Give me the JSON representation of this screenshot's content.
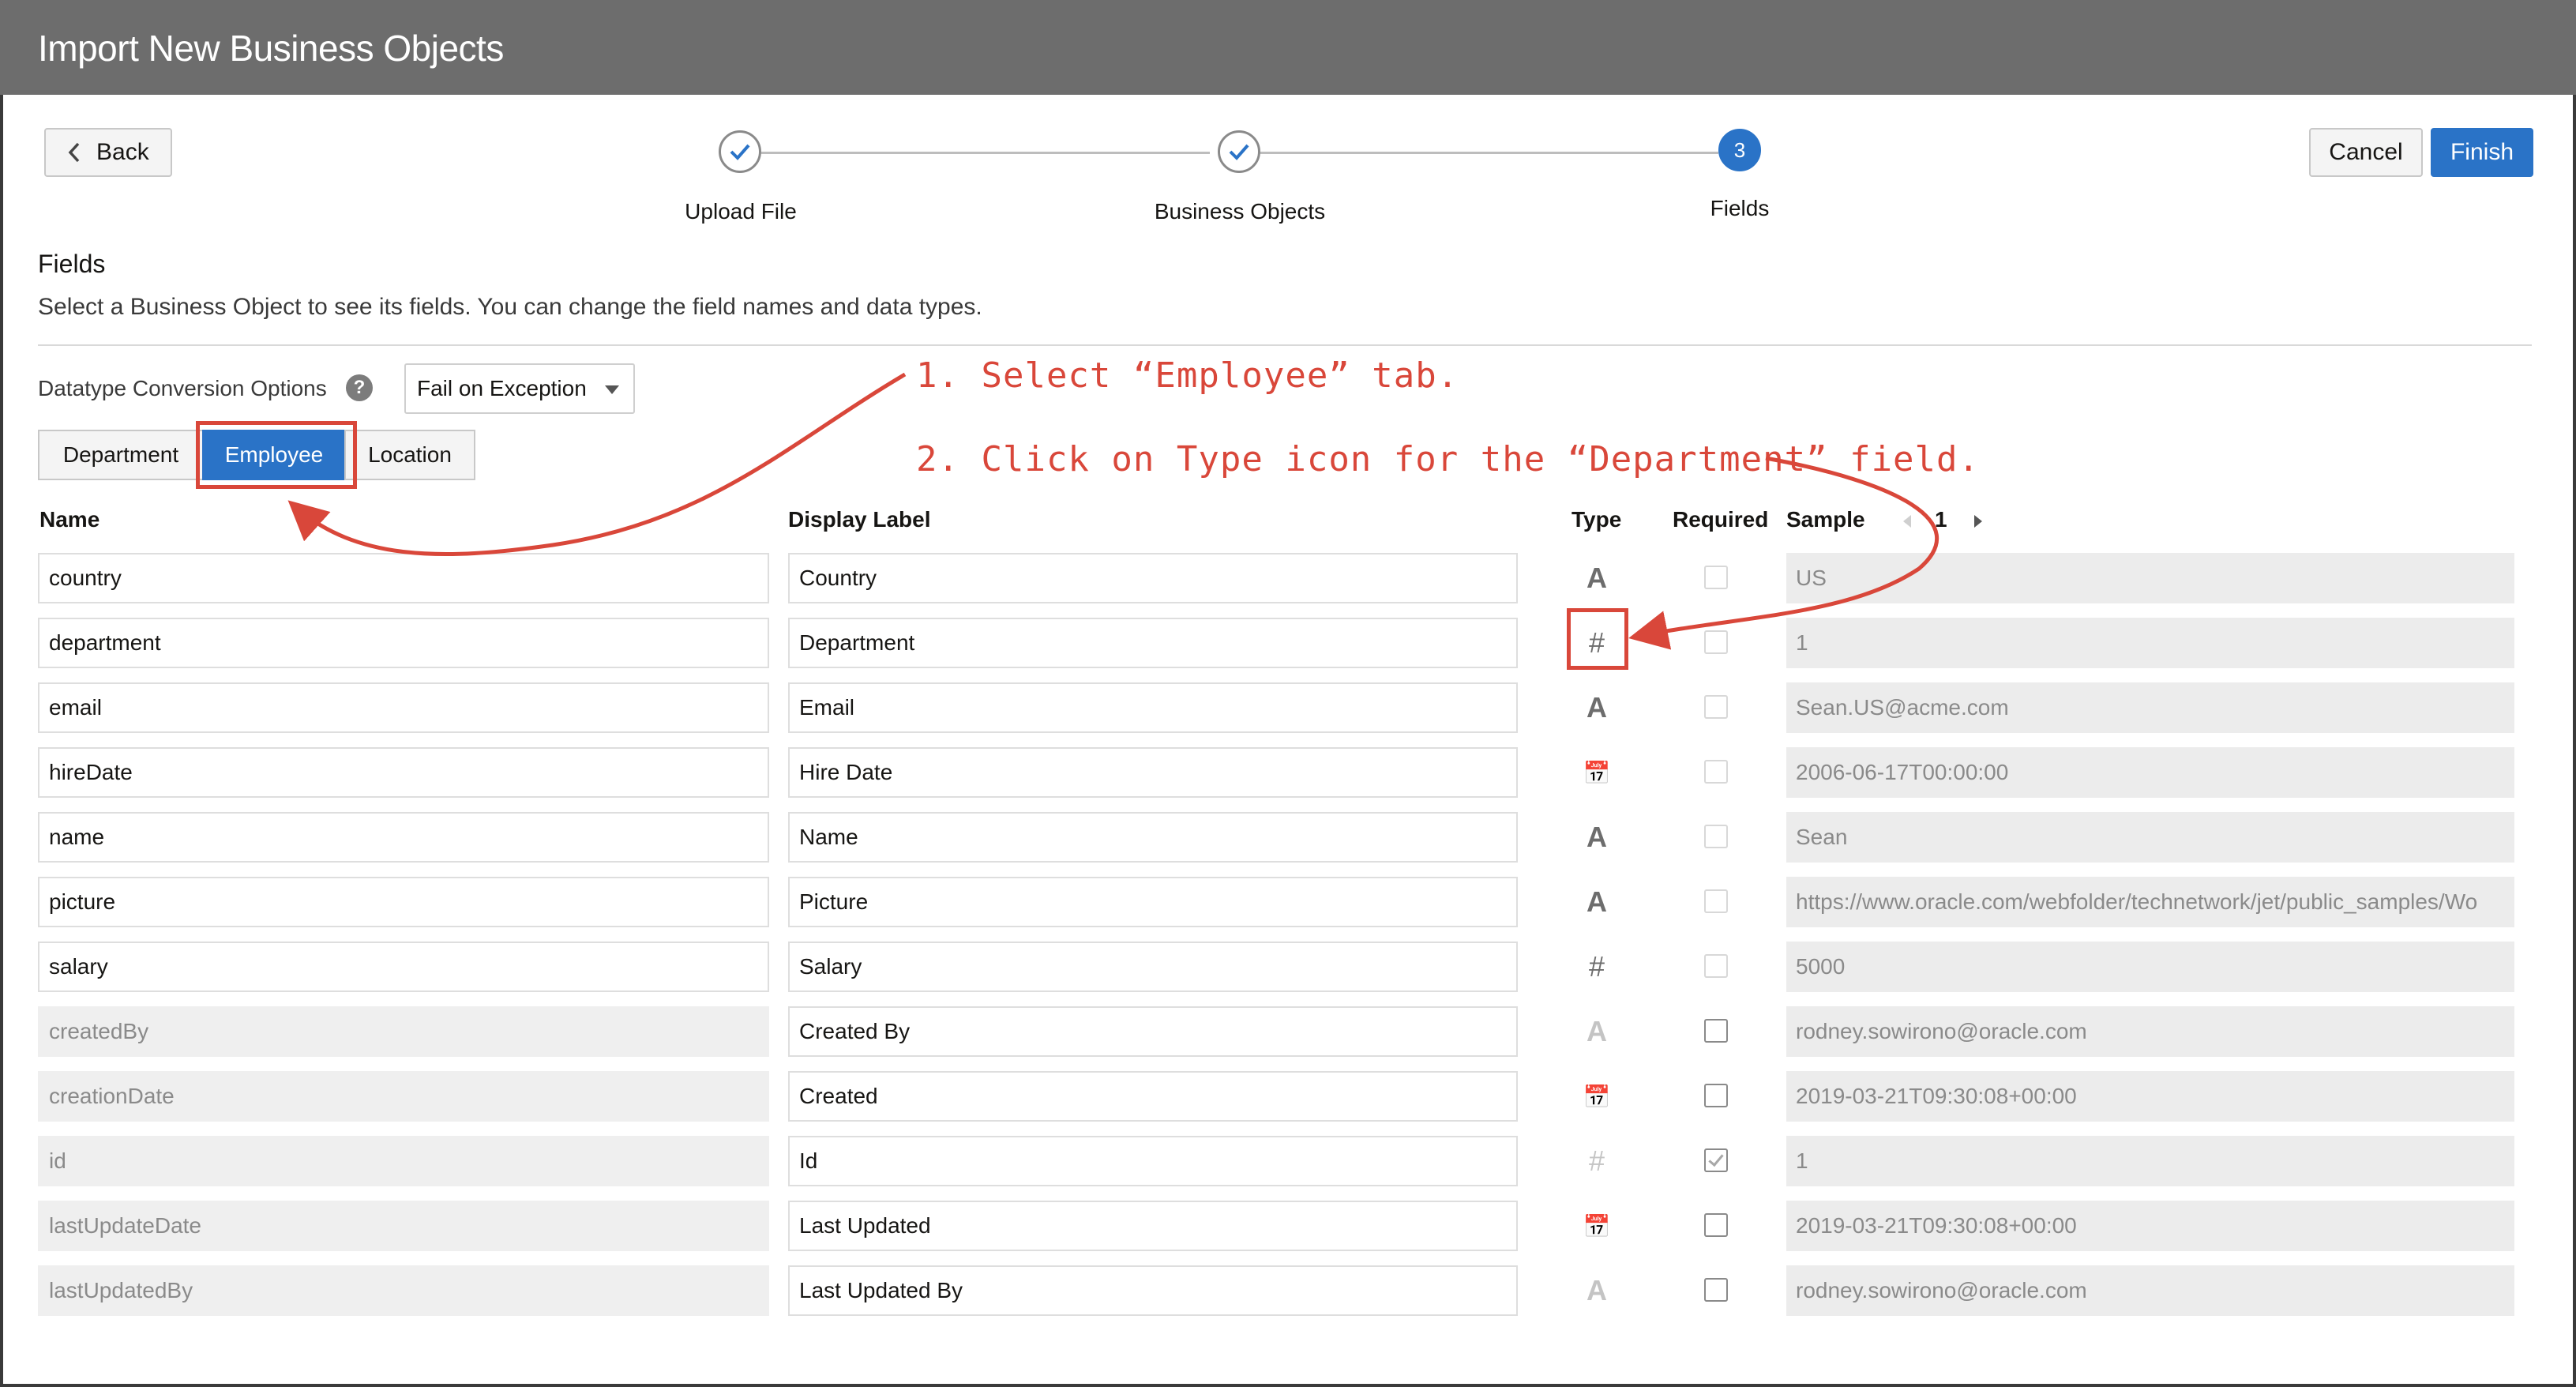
{
  "window": {
    "title": "Import New Business Objects"
  },
  "nav": {
    "back": "Back",
    "cancel": "Cancel",
    "finish": "Finish"
  },
  "train": {
    "steps": [
      {
        "label": "Upload File",
        "state": "done"
      },
      {
        "label": "Business Objects",
        "state": "done"
      },
      {
        "label": "Fields",
        "state": "current",
        "number": "3"
      }
    ]
  },
  "section": {
    "title": "Fields",
    "description": "Select a Business Object to see its fields. You can change the field names and data types."
  },
  "conversion": {
    "label": "Datatype Conversion Options",
    "value": "Fail on Exception",
    "help": "?"
  },
  "tabs": [
    {
      "label": "Department",
      "selected": false
    },
    {
      "label": "Employee",
      "selected": true
    },
    {
      "label": "Location",
      "selected": false
    }
  ],
  "table": {
    "headers": {
      "name": "Name",
      "display": "Display Label",
      "type": "Type",
      "required": "Required",
      "sample": "Sample"
    },
    "page": "1",
    "rows": [
      {
        "name": "country",
        "display": "Country",
        "type": "text",
        "glyph": "A",
        "required": false,
        "system": false,
        "sample": "US"
      },
      {
        "name": "department",
        "display": "Department",
        "type": "number",
        "glyph": "#",
        "required": false,
        "system": false,
        "sample": "1"
      },
      {
        "name": "email",
        "display": "Email",
        "type": "text",
        "glyph": "A",
        "required": false,
        "system": false,
        "sample": "Sean.US@acme.com"
      },
      {
        "name": "hireDate",
        "display": "Hire Date",
        "type": "datetime",
        "glyph": "📅",
        "required": false,
        "system": false,
        "sample": "2006-06-17T00:00:00"
      },
      {
        "name": "name",
        "display": "Name",
        "type": "text",
        "glyph": "A",
        "required": false,
        "system": false,
        "sample": "Sean"
      },
      {
        "name": "picture",
        "display": "Picture",
        "type": "text",
        "glyph": "A",
        "required": false,
        "system": false,
        "sample": "https://www.oracle.com/webfolder/technetwork/jet/public_samples/Wo"
      },
      {
        "name": "salary",
        "display": "Salary",
        "type": "number",
        "glyph": "#",
        "required": false,
        "system": false,
        "sample": "5000"
      },
      {
        "name": "createdBy",
        "display": "Created By",
        "type": "text",
        "glyph": "A",
        "required": false,
        "system": true,
        "sample": "rodney.sowirono@oracle.com"
      },
      {
        "name": "creationDate",
        "display": "Created",
        "type": "datetime",
        "glyph": "📅",
        "required": false,
        "system": true,
        "sample": "2019-03-21T09:30:08+00:00"
      },
      {
        "name": "id",
        "display": "Id",
        "type": "number",
        "glyph": "#",
        "required": true,
        "system": true,
        "sample": "1"
      },
      {
        "name": "lastUpdateDate",
        "display": "Last Updated",
        "type": "datetime",
        "glyph": "📅",
        "required": false,
        "system": true,
        "sample": "2019-03-21T09:30:08+00:00"
      },
      {
        "name": "lastUpdatedBy",
        "display": "Last Updated By",
        "type": "text",
        "glyph": "A",
        "required": false,
        "system": true,
        "sample": "rodney.sowirono@oracle.com"
      }
    ]
  },
  "annotations": {
    "step1": "1. Select “Employee” tab.",
    "step2": "2. Click on Type icon for the “Department” field."
  },
  "colors": {
    "accent": "#2a73c7",
    "annotation": "#d9473a",
    "titlebar": "#6d6d6d"
  }
}
